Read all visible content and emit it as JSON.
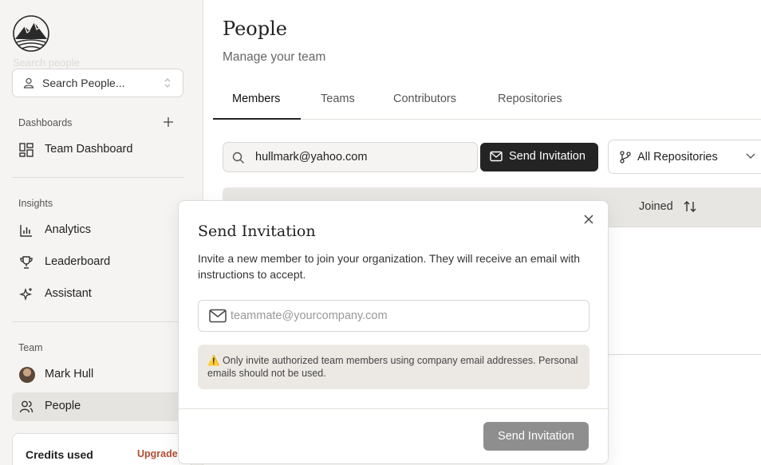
{
  "sidebar": {
    "search_label": "Search people",
    "search_placeholder": "Search People...",
    "dashboards_title": "Dashboards",
    "dashboard_items": [
      {
        "label": "Team Dashboard"
      }
    ],
    "insights_title": "Insights",
    "insights_items": [
      {
        "label": "Analytics"
      },
      {
        "label": "Leaderboard"
      },
      {
        "label": "Assistant"
      }
    ],
    "team_title": "Team",
    "team_items": [
      {
        "label": "Mark Hull"
      },
      {
        "label": "People"
      }
    ],
    "credits": {
      "title": "Credits used",
      "upgrade": "Upgrade"
    }
  },
  "main": {
    "title": "People",
    "subtitle": "Manage your team",
    "tabs": [
      {
        "label": "Members"
      },
      {
        "label": "Teams"
      },
      {
        "label": "Contributors"
      },
      {
        "label": "Repositories"
      }
    ],
    "email_value": "hullmark@yahoo.com",
    "send_invitation_label": "Send Invitation",
    "repo_filter": "All Repositories",
    "table": {
      "joined_header": "Joined"
    }
  },
  "modal": {
    "title": "Send Invitation",
    "description": "Invite a new member to join your organization. They will receive an email with instructions to accept.",
    "email_placeholder": "teammate@yourcompany.com",
    "warning": "⚠️ Only invite authorized team members using company email addresses. Personal emails should not be used.",
    "submit_label": "Send Invitation"
  },
  "colors": {
    "primary_button": "#242424",
    "disabled_button": "#8e8e8e",
    "upgrade": "#b24c33",
    "sidebar_bg": "#f5f4f2"
  }
}
